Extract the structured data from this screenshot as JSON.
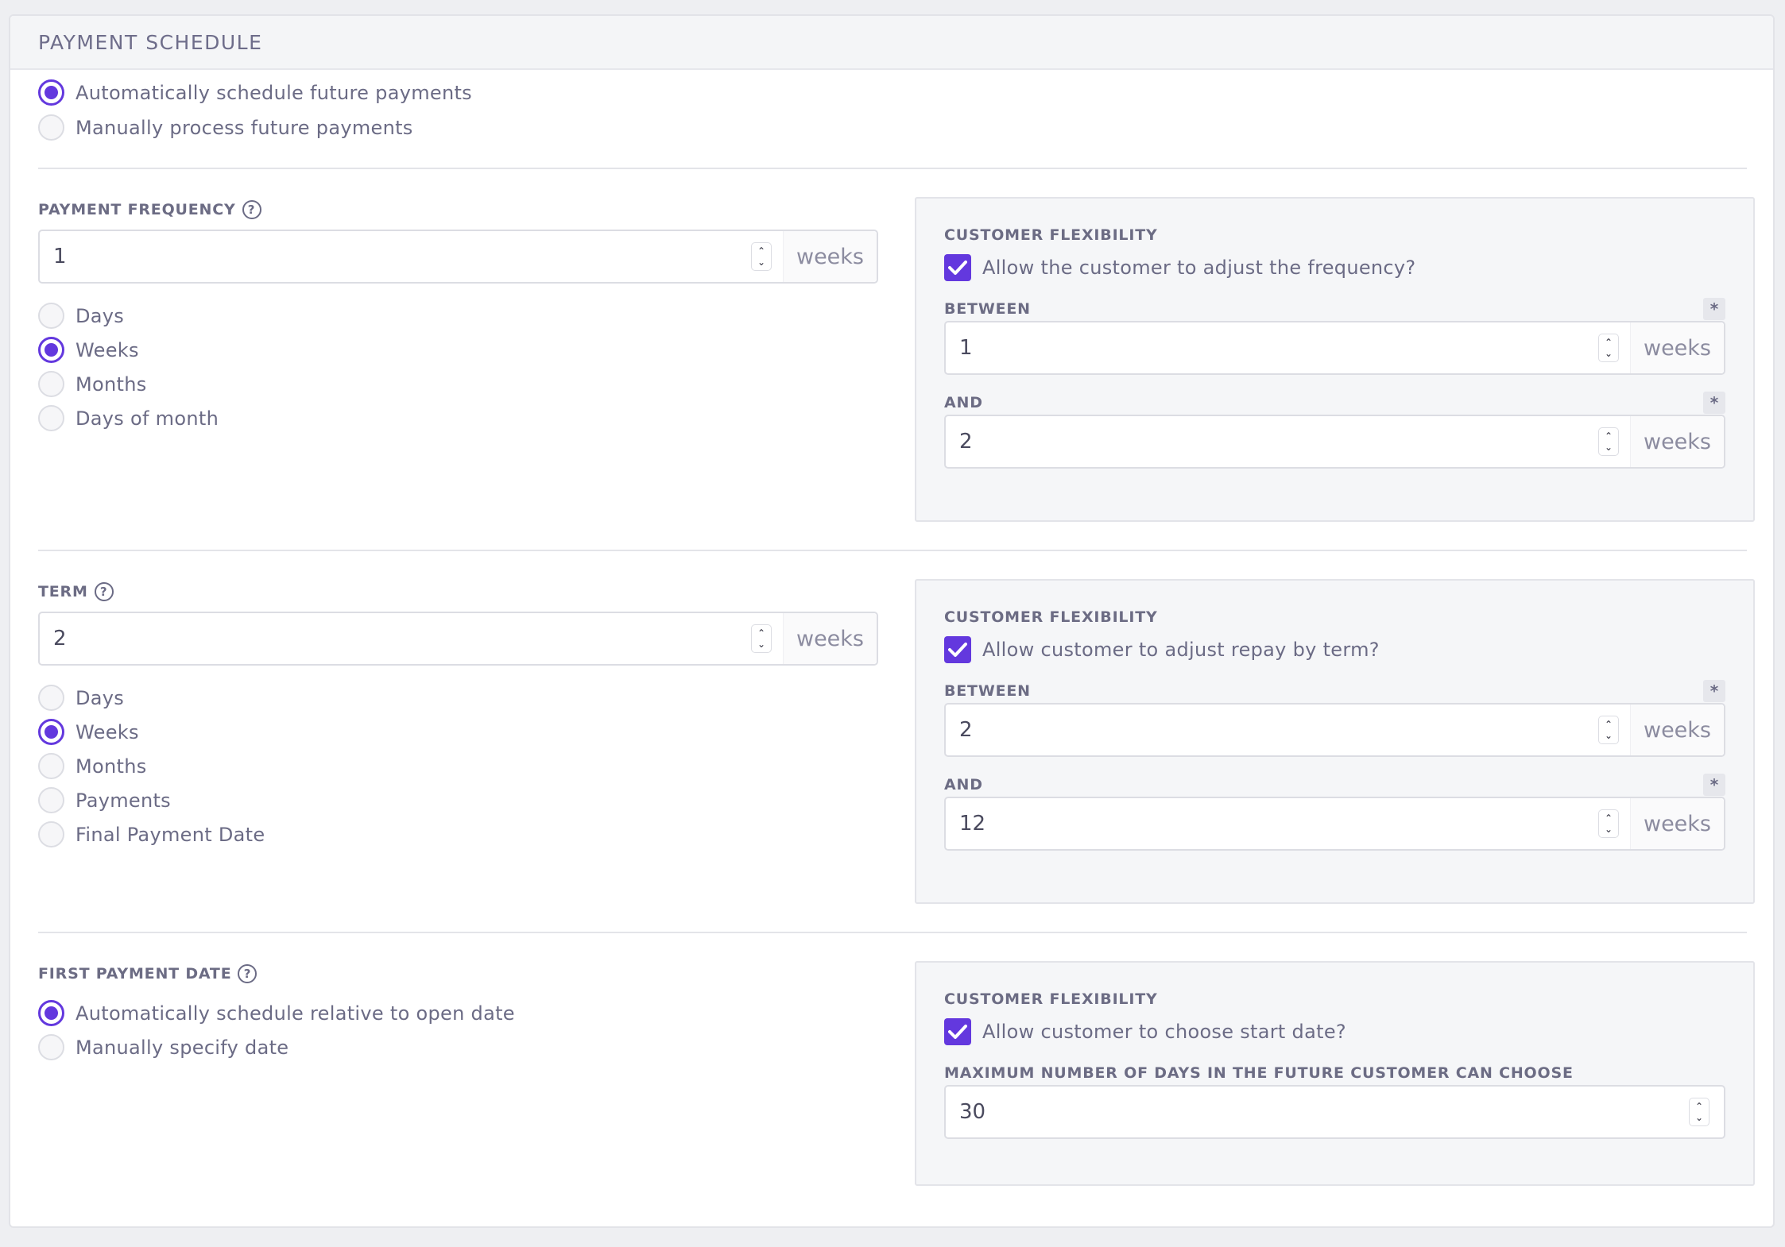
{
  "card": {
    "title": "PAYMENT SCHEDULE"
  },
  "schedule_mode": {
    "options": [
      {
        "label": "Automatically schedule future payments",
        "selected": true
      },
      {
        "label": "Manually process future payments",
        "selected": false
      }
    ]
  },
  "frequency": {
    "label": "PAYMENT FREQUENCY",
    "help": "?",
    "value": "1",
    "unit": "weeks",
    "options": [
      {
        "label": "Days",
        "selected": false
      },
      {
        "label": "Weeks",
        "selected": true
      },
      {
        "label": "Months",
        "selected": false
      },
      {
        "label": "Days of month",
        "selected": false
      }
    ],
    "flex": {
      "title": "CUSTOMER FLEXIBILITY",
      "checkbox_label": "Allow the customer to adjust the frequency?",
      "checked": true,
      "between_label": "BETWEEN",
      "between_value": "1",
      "and_label": "AND",
      "and_value": "2",
      "unit": "weeks",
      "required_mark": "*"
    }
  },
  "term": {
    "label": "TERM",
    "help": "?",
    "value": "2",
    "unit": "weeks",
    "options": [
      {
        "label": "Days",
        "selected": false
      },
      {
        "label": "Weeks",
        "selected": true
      },
      {
        "label": "Months",
        "selected": false
      },
      {
        "label": "Payments",
        "selected": false
      },
      {
        "label": "Final Payment Date",
        "selected": false
      }
    ],
    "flex": {
      "title": "CUSTOMER FLEXIBILITY",
      "checkbox_label": "Allow customer to adjust repay by term?",
      "checked": true,
      "between_label": "BETWEEN",
      "between_value": "2",
      "and_label": "AND",
      "and_value": "12",
      "unit": "weeks",
      "required_mark": "*"
    }
  },
  "first_payment": {
    "label": "FIRST PAYMENT DATE",
    "help": "?",
    "options": [
      {
        "label": "Automatically schedule relative to open date",
        "selected": true
      },
      {
        "label": "Manually specify date",
        "selected": false
      }
    ],
    "flex": {
      "title": "CUSTOMER FLEXIBILITY",
      "checkbox_label": "Allow customer to choose start date?",
      "checked": true,
      "max_days_label": "MAXIMUM NUMBER OF DAYS IN THE FUTURE CUSTOMER CAN CHOOSE",
      "max_days_value": "30"
    }
  },
  "icons": {
    "radio": "radio-icon",
    "check": "checkmark-icon",
    "help": "question-circle-icon",
    "spinner": "number-spinner-icon"
  },
  "colors": {
    "accent": "#6338de",
    "text": "#6b6b85",
    "panel": "#f5f6f8"
  }
}
